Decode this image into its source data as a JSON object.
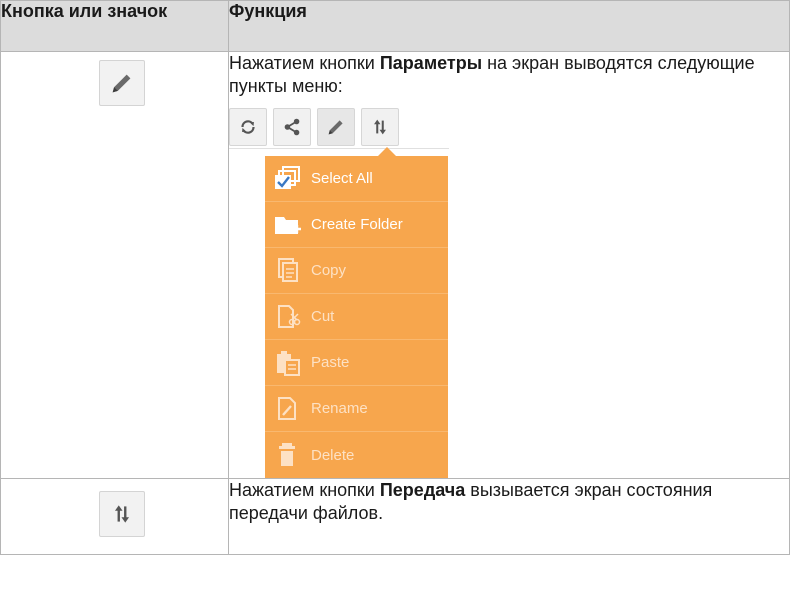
{
  "table": {
    "header": {
      "col1": "Кнопка или значок",
      "col2": "Функция"
    },
    "rows": [
      {
        "icon": "pencil-icon",
        "text_before": "Нажатием кнопки ",
        "bold": "Параметры",
        "text_after": " на экран выводятся следующие пункты меню:",
        "toolbar": [
          "refresh-icon",
          "share-icon",
          "pencil-icon",
          "transfer-icon"
        ],
        "menu": [
          {
            "label": "Select All",
            "icon": "select-all-icon",
            "enabled": true
          },
          {
            "label": "Create Folder",
            "icon": "folder-add-icon",
            "enabled": true
          },
          {
            "label": "Copy",
            "icon": "copy-icon",
            "enabled": false
          },
          {
            "label": "Cut",
            "icon": "cut-icon",
            "enabled": false
          },
          {
            "label": "Paste",
            "icon": "paste-icon",
            "enabled": false
          },
          {
            "label": "Rename",
            "icon": "rename-icon",
            "enabled": false
          },
          {
            "label": "Delete",
            "icon": "delete-icon",
            "enabled": false
          }
        ]
      },
      {
        "icon": "transfer-icon",
        "text_before": "Нажатием кнопки ",
        "bold": "Передача",
        "text_after": " вызывается экран состояния передачи файлов."
      }
    ]
  },
  "colors": {
    "menu_bg": "#f7a64d",
    "header_bg": "#dcdcdc",
    "border": "#b5b5b5"
  }
}
